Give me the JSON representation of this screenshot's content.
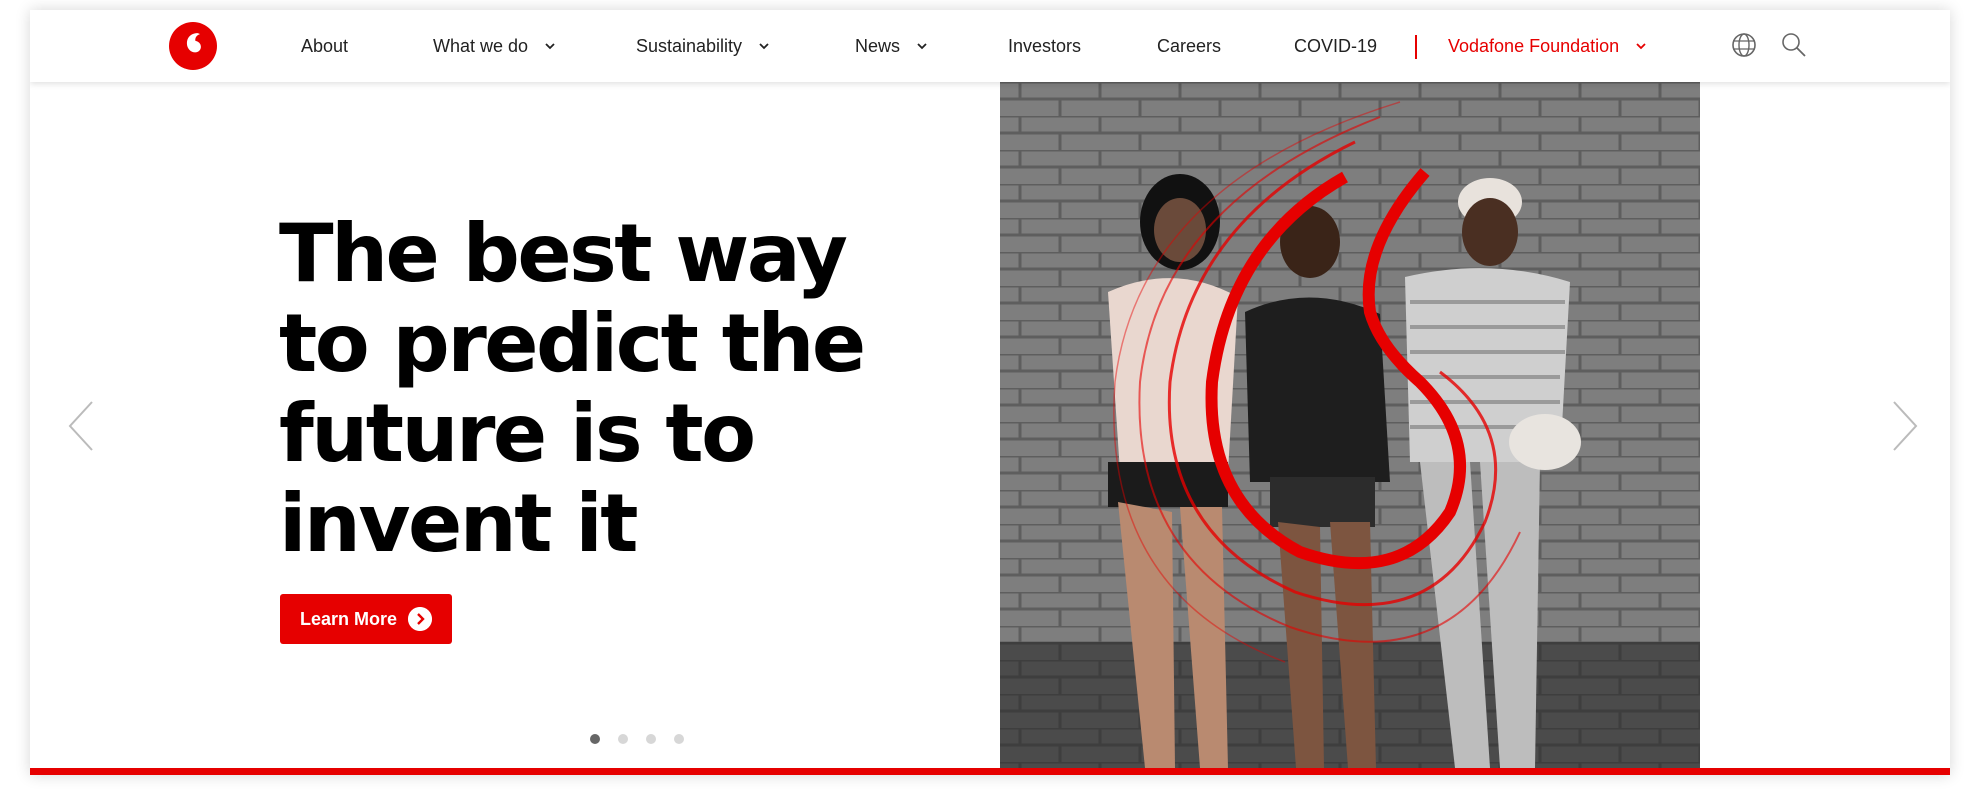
{
  "brand": {
    "accent": "#e60000",
    "logo_icon": "vodafone-speechmark-logo"
  },
  "nav": {
    "items": [
      {
        "label": "About",
        "has_dropdown": false
      },
      {
        "label": "What we do",
        "has_dropdown": true
      },
      {
        "label": "Sustainability",
        "has_dropdown": true
      },
      {
        "label": "News",
        "has_dropdown": true
      },
      {
        "label": "Investors",
        "has_dropdown": false
      },
      {
        "label": "Careers",
        "has_dropdown": false
      },
      {
        "label": "COVID-19",
        "has_dropdown": false
      }
    ],
    "foundation": {
      "label": "Vodafone Foundation",
      "has_dropdown": true
    },
    "icons": [
      "globe-icon",
      "search-icon"
    ]
  },
  "hero": {
    "title": "The best way to predict the future is to invent it",
    "cta_label": "Learn More",
    "cta_icon": "chevron-right-circle-icon",
    "image_description_icon": "hero-photo",
    "slides": {
      "count": 4,
      "active_index": 0
    }
  },
  "carousel": {
    "prev_icon": "chevron-left-icon",
    "next_icon": "chevron-right-icon"
  }
}
